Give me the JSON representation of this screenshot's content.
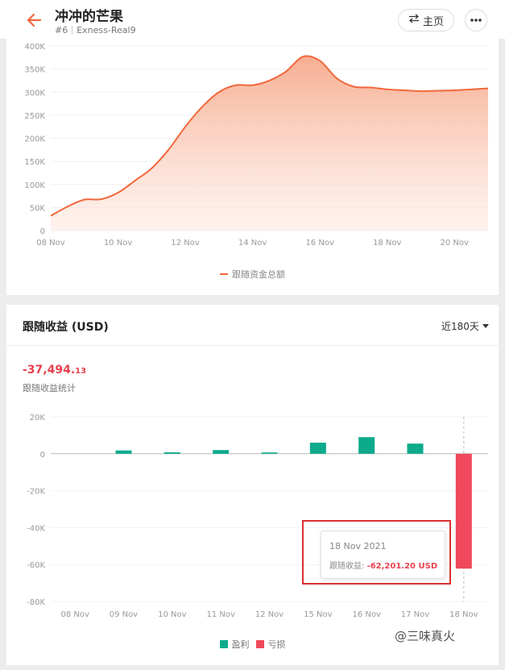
{
  "header": {
    "title": "冲冲的芒果",
    "rank": "#6",
    "account": "Exness-Real9",
    "home_label": "主页"
  },
  "balance_chart": {
    "legend": "跟随资金总额",
    "color": "#f2673c",
    "chart_data": {
      "type": "area",
      "x_ticks": [
        "08 Nov",
        "10 Nov",
        "12 Nov",
        "14 Nov",
        "16 Nov",
        "18 Nov",
        "20 Nov"
      ],
      "y_ticks": [
        "0",
        "50K",
        "100K",
        "150K",
        "200K",
        "250K",
        "300K",
        "350K",
        "400K"
      ],
      "ylim": [
        0,
        400000
      ],
      "xlim": [
        0,
        13
      ],
      "series": [
        {
          "name": "跟随资金总额",
          "x": [
            0,
            0.5,
            1,
            1.5,
            2,
            2.5,
            3,
            3.5,
            4,
            4.5,
            5,
            5.5,
            6,
            6.5,
            7,
            7.5,
            8,
            8.5,
            9,
            9.5,
            10,
            10.5,
            11,
            11.5,
            12,
            12.5,
            13
          ],
          "values": [
            32000,
            52000,
            67000,
            68000,
            82000,
            108000,
            135000,
            175000,
            225000,
            268000,
            300000,
            315000,
            315000,
            325000,
            345000,
            377000,
            368000,
            330000,
            312000,
            310000,
            306000,
            304000,
            302000,
            303000,
            304000,
            306000,
            308000
          ]
        }
      ]
    }
  },
  "profit_section": {
    "title": "跟随收益 (USD)",
    "period": "近180天",
    "total_main": "-37,494.",
    "total_cents": "13",
    "total_label": "跟随收益统计",
    "legend_profit": "盈利",
    "legend_loss": "亏损",
    "profit_color": "#0daa8c",
    "loss_color": "#f0485c",
    "tooltip": {
      "date": "18 Nov 2021",
      "label": "跟随收益: ",
      "value": "-62,201.20 USD"
    },
    "chart_data": {
      "type": "bar",
      "categories": [
        "08 Nov",
        "09 Nov",
        "10 Nov",
        "11 Nov",
        "12 Nov",
        "15 Nov",
        "16 Nov",
        "17 Nov",
        "18 Nov"
      ],
      "values": [
        0,
        1800,
        800,
        2000,
        700,
        6000,
        9000,
        5500,
        -62201.2
      ],
      "y_ticks": [
        "20K",
        "0",
        "-20K",
        "-40K",
        "-60K",
        "-80K"
      ],
      "ylim": [
        -80000,
        20000
      ]
    }
  },
  "watermark": "@三味真火"
}
